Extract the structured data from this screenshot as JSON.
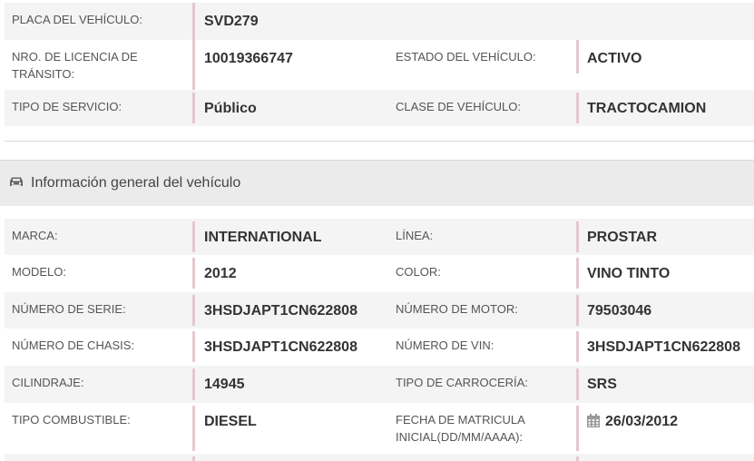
{
  "top_rows": [
    {
      "label1": "PLACA DEL VEHÍCULO:",
      "value1": "SVD279"
    },
    {
      "label1": "NRO. DE LICENCIA DE TRÁNSITO:",
      "value1": "10019366747",
      "label2": "ESTADO DEL VEHÍCULO:",
      "value2": "ACTIVO"
    },
    {
      "label1": "TIPO DE SERVICIO:",
      "value1": "Público",
      "label2": "CLASE DE VEHÍCULO:",
      "value2": "TRACTOCAMION"
    }
  ],
  "section": {
    "title": "Información general del vehículo",
    "icon": "car-icon"
  },
  "rows": [
    {
      "label1": "MARCA:",
      "value1": "INTERNATIONAL",
      "label2": "LÍNEA:",
      "value2": "PROSTAR"
    },
    {
      "label1": "MODELO:",
      "value1": "2012",
      "label2": "COLOR:",
      "value2": "VINO TINTO"
    },
    {
      "label1": "NÚMERO DE SERIE:",
      "value1": "3HSDJAPT1CN622808",
      "label2": "NÚMERO DE MOTOR:",
      "value2": "79503046"
    },
    {
      "label1": "NÚMERO DE CHASIS:",
      "value1": "3HSDJAPT1CN622808",
      "label2": "NÚMERO DE VIN:",
      "value2": "3HSDJAPT1CN622808"
    },
    {
      "label1": "CILINDRAJE:",
      "value1": "14945",
      "label2": "TIPO DE CARROCERÍA:",
      "value2": "SRS"
    },
    {
      "label1": "TIPO COMBUSTIBLE:",
      "value1": "DIESEL",
      "label2": "FECHA DE MATRICULA INICIAL(DD/MM/AAAA):",
      "value2": "26/03/2012",
      "value2_icon": "calendar-icon"
    }
  ]
}
